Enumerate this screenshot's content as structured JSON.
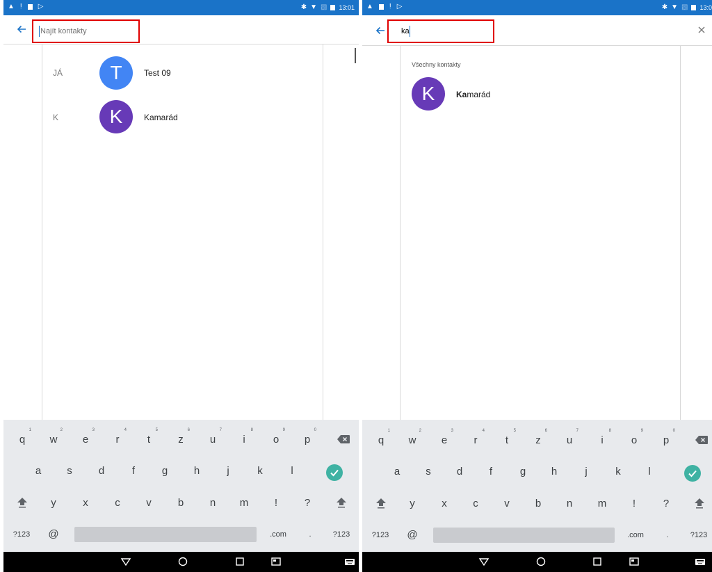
{
  "left_screen": {
    "status_time": "13:01",
    "search": {
      "value": "",
      "placeholder": "Najít kontakty"
    },
    "sections": [
      {
        "letter": "JÁ",
        "contact": {
          "initial": "T",
          "name": "Test 09",
          "color": "#4285f4"
        }
      },
      {
        "letter": "K",
        "contact": {
          "initial": "K",
          "name": "Kamarád",
          "color": "#673ab7"
        }
      }
    ]
  },
  "right_screen": {
    "status_time": "13:0",
    "search": {
      "value": "ka",
      "placeholder": ""
    },
    "list_header": "Všechny kontakty",
    "result": {
      "initial": "K",
      "name_match": "Ka",
      "name_rest": "marád",
      "color": "#673ab7"
    }
  },
  "keyboard": {
    "row1": [
      "q",
      "w",
      "e",
      "r",
      "t",
      "z",
      "u",
      "i",
      "o",
      "p"
    ],
    "row1_hints": [
      "1",
      "2",
      "3",
      "4",
      "5",
      "6",
      "7",
      "8",
      "9",
      "0"
    ],
    "row2": [
      "a",
      "s",
      "d",
      "f",
      "g",
      "h",
      "j",
      "k",
      "l"
    ],
    "row3": [
      "y",
      "x",
      "c",
      "v",
      "b",
      "n",
      "m",
      "!",
      "?"
    ],
    "symbols_label": "?123",
    "at_label": "@",
    "dotcom_label": ".com",
    "period_label": "."
  },
  "colors": {
    "status_bar": "#1a73c8",
    "accent": "#1a73c8",
    "highlight_box": "#e00000",
    "keyboard_bg": "#e8eaed",
    "enter_key": "#3fb2a3"
  },
  "icons": {
    "status": [
      "warning-icon",
      "alert-icon",
      "image-icon",
      "play-store-icon",
      "bluetooth-icon",
      "wifi-icon",
      "no-sim-icon",
      "battery-icon"
    ],
    "search": [
      "back-arrow-icon",
      "clear-icon"
    ],
    "keyboard": [
      "backspace-icon",
      "enter-check-icon",
      "shift-icon"
    ],
    "nav": [
      "back-triangle-icon",
      "home-circle-icon",
      "recents-square-icon",
      "screenshot-icon",
      "keyboard-switch-icon"
    ]
  }
}
